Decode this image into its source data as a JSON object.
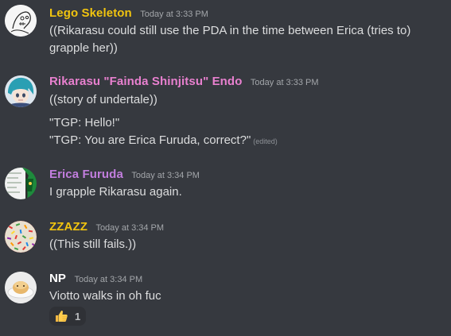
{
  "messages": [
    {
      "username": "Lego Skeleton",
      "timestamp": "Today at 3:33 PM",
      "color": "#f1c40f",
      "lines": [
        "((Rikarasu could still use the PDA in the time between Erica (tries to)",
        "grapple her))"
      ]
    },
    {
      "username": "Rikarasu \"Fainda Shinjitsu\" Endo",
      "timestamp": "Today at 3:33 PM",
      "color": "#e880cf",
      "lines": [
        "((story of undertale))",
        "\"TGP: Hello!\"",
        "\"TGP: You are Erica Furuda, correct?\""
      ],
      "edited": "(edited)"
    },
    {
      "username": "Erica Furuda",
      "timestamp": "Today at 3:34 PM",
      "color": "#c27ede",
      "lines": [
        "I grapple Rikarasu again."
      ]
    },
    {
      "username": "ZZAZZ",
      "timestamp": "Today at 3:34 PM",
      "color": "#f1c40f",
      "lines": [
        "((This still fails.))"
      ]
    },
    {
      "username": "NP",
      "timestamp": "Today at 3:34 PM",
      "color": "#ffffff",
      "lines": [
        "Viotto walks in oh fuc"
      ],
      "reaction": {
        "emoji": "thumbs-up-icon",
        "count": "1"
      }
    }
  ]
}
